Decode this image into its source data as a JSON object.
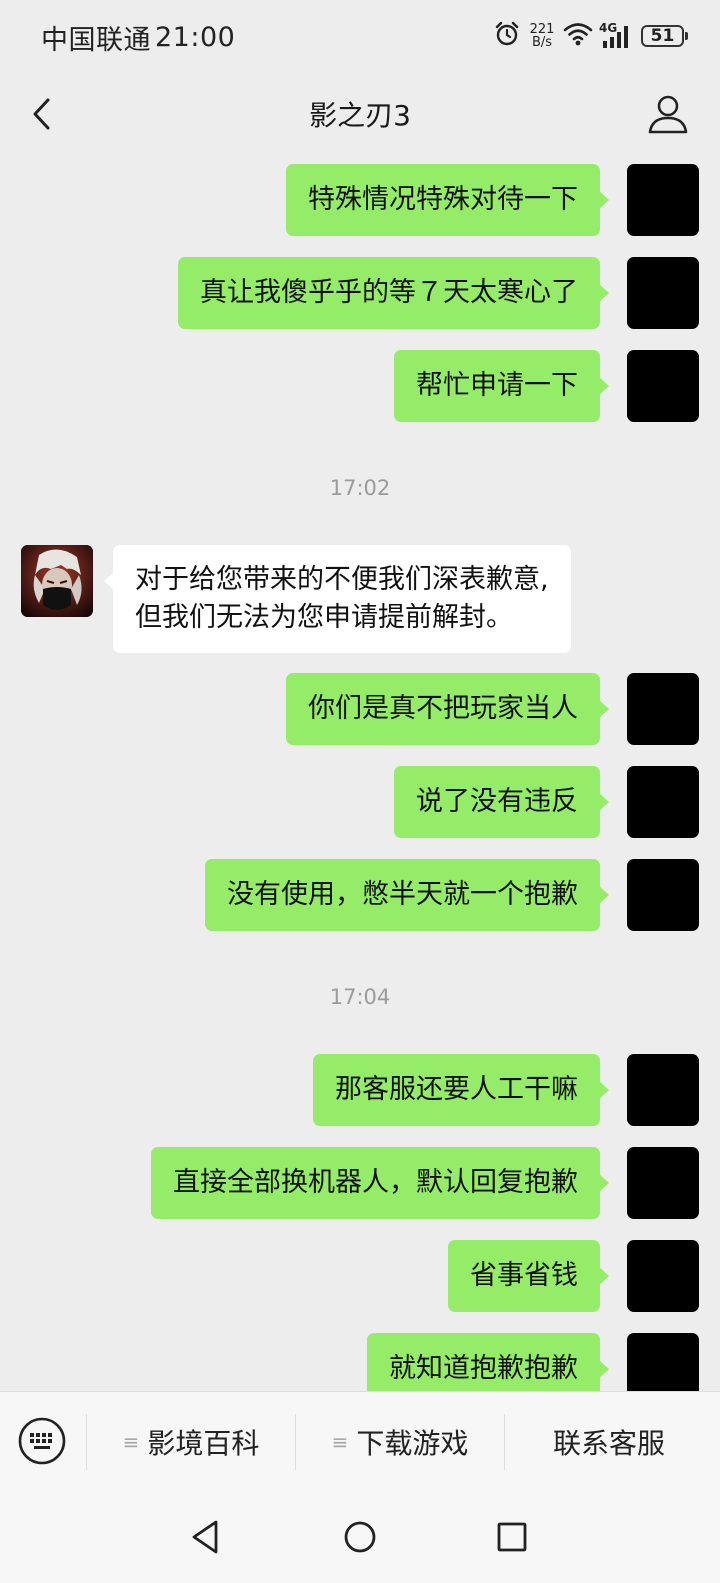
{
  "status_bar": {
    "carrier": "中国联通",
    "time": "21:00",
    "net_speed_value": "221",
    "net_speed_unit": "B/s",
    "network": "4G",
    "battery": "51"
  },
  "nav": {
    "title": "影之刃3",
    "back_icon": "chevron-left-icon",
    "profile_icon": "person-icon"
  },
  "chat": {
    "messages": [
      {
        "type": "self",
        "text": "特殊情况特殊对待一下"
      },
      {
        "type": "self",
        "text": "真让我傻乎乎的等７天太寒心了"
      },
      {
        "type": "self",
        "text": "帮忙申请一下"
      },
      {
        "type": "time",
        "text": "17:02"
      },
      {
        "type": "other",
        "lines": [
          "对于给您带来的不便我们深表歉意,",
          "但我们无法为您申请提前解封。"
        ]
      },
      {
        "type": "self",
        "text": "你们是真不把玩家当人"
      },
      {
        "type": "self",
        "text": "说了没有违反"
      },
      {
        "type": "self",
        "text": "没有使用，憋半天就一个抱歉"
      },
      {
        "type": "time",
        "text": "17:04"
      },
      {
        "type": "self",
        "text": "那客服还要人工干嘛"
      },
      {
        "type": "self",
        "text": "直接全部换机器人，默认回复抱歉"
      },
      {
        "type": "self",
        "text": "省事省钱"
      },
      {
        "type": "self",
        "text": "就知道抱歉抱歉"
      }
    ]
  },
  "menu": {
    "keyboard_icon": "keyboard-icon",
    "items": [
      {
        "label": "影境百科",
        "icon": "menu-lines-icon"
      },
      {
        "label": "下载游戏",
        "icon": "menu-lines-icon"
      },
      {
        "label": "联系客服"
      }
    ]
  },
  "system_nav": {
    "back_icon": "triangle-back-icon",
    "home_icon": "circle-home-icon",
    "recents_icon": "square-recents-icon"
  },
  "colors": {
    "background": "#ededed",
    "self_bubble": "#95ec69",
    "other_bubble": "#ffffff",
    "timestamp": "#9b9b9b"
  }
}
